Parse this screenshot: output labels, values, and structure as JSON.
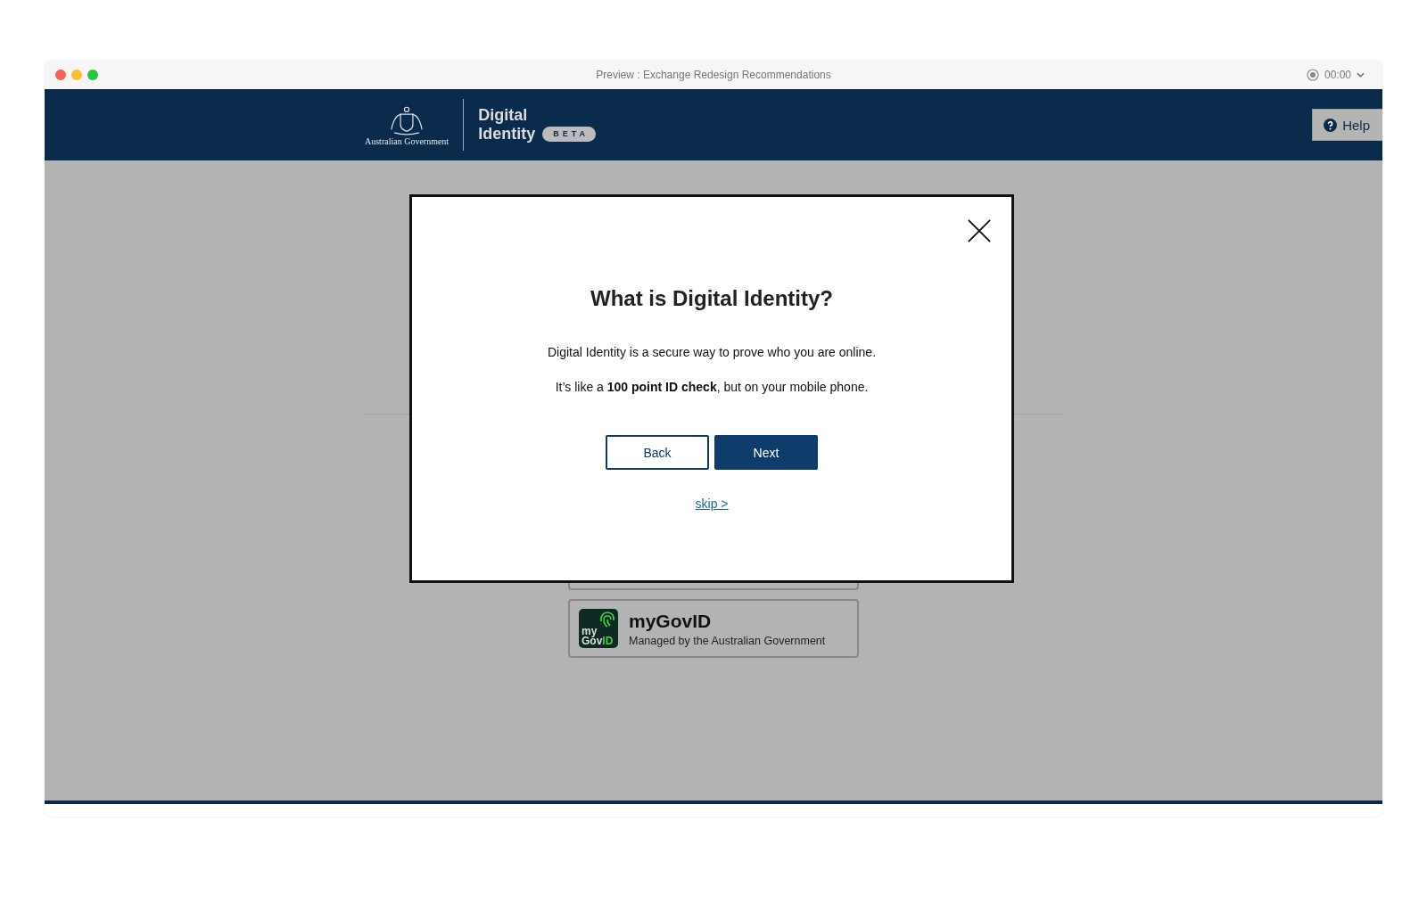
{
  "window": {
    "title": "Preview : Exchange Redesign Recommendations",
    "timer": "00:00"
  },
  "header": {
    "gov_label": "Australian Government",
    "title_line1": "Digital",
    "title_line2": "Identity",
    "badge": "BETA",
    "help": "Help"
  },
  "option": {
    "logo_top": "my",
    "logo_bottom_plain": "Gov",
    "logo_bottom_accent": "ID",
    "name": "myGovID",
    "subtitle": "Managed by the Australian Government"
  },
  "modal": {
    "title": "What is Digital Identity?",
    "paragraphs": [
      "Digital Identity is a secure way to prove who you are online.",
      "It’s like a **100 point ID check**, but on your mobile phone."
    ],
    "buttons": [
      {
        "label": "Back",
        "kind": "secondary"
      },
      {
        "label": "Next",
        "kind": "primary"
      }
    ],
    "skip": "skip >"
  }
}
